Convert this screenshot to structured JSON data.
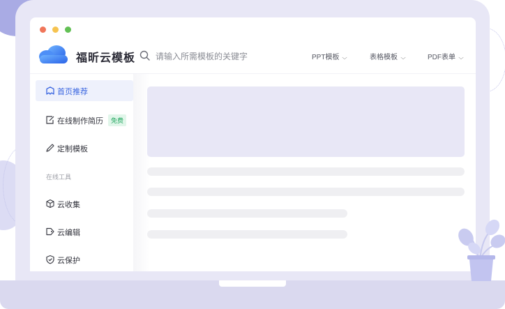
{
  "brand": {
    "name": "福昕云模板"
  },
  "search": {
    "placeholder": "请输入所需模板的关键字",
    "icon": "search-icon"
  },
  "nav": [
    {
      "label": "PPT模板",
      "icon": "chevron-down-icon"
    },
    {
      "label": "表格模板",
      "icon": "chevron-down-icon"
    },
    {
      "label": "PDF表单",
      "icon": "chevron-down-icon"
    }
  ],
  "sidebar": {
    "items": [
      {
        "label": "首页推荐",
        "icon": "home-icon",
        "active": true
      },
      {
        "label": "在线制作简历",
        "icon": "edit-doc-icon",
        "badge": "免费"
      },
      {
        "label": "定制模板",
        "icon": "pencil-icon"
      }
    ],
    "section_label": "在线工具",
    "tools": [
      {
        "label": "云收集",
        "icon": "box-icon"
      },
      {
        "label": "云编辑",
        "icon": "tag-icon"
      },
      {
        "label": "云保护",
        "icon": "shield-icon"
      }
    ]
  },
  "colors": {
    "accent": "#3a66e0",
    "badge_text": "#27a862",
    "badge_bg": "#e1f6ea",
    "frame": "#e8e7f6",
    "placeholder": "#efeff2"
  }
}
